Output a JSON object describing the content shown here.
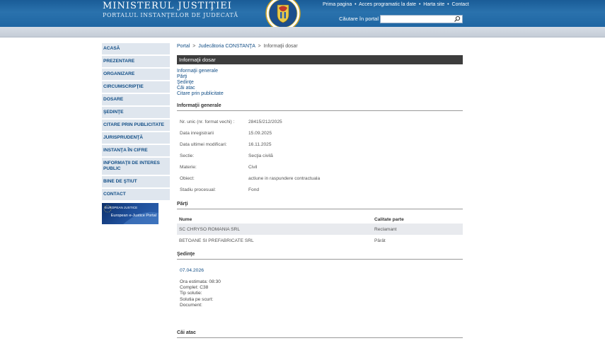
{
  "header": {
    "title": "MINISTERUL JUSTIŢIEI",
    "subtitle": "PORTALUL INSTANŢELOR DE JUDECATĂ",
    "links": [
      "Prima pagina",
      "Acces programatic la date",
      "Harta site",
      "Contact"
    ],
    "search_label": "Căutare în portal",
    "search_value": ""
  },
  "menu": {
    "items": [
      "ACASĂ",
      "PREZENTARE",
      "ORGANIZARE",
      "CIRCUMSCRIPŢIE",
      "DOSARE",
      "ŞEDINŢE",
      "CITARE PRIN PUBLICITATE",
      "JURISPRUDENŢĂ",
      "INSTANŢA ÎN CIFRE",
      "INFORMAŢII DE INTERES PUBLIC",
      "BINE DE ŞTIUT",
      "CONTACT"
    ],
    "ejustice_top": "EUROPEAN JUSTICE",
    "ejustice_label": "European e-Justice Portal"
  },
  "breadcrumb": {
    "portal": "Portal",
    "court": "Judecătoria CONSTANŢA",
    "current": "Informaţii dosar"
  },
  "page_title": "Informaţii dosar",
  "anchors": [
    "Informaţii generale",
    "Părţi",
    "Şedinţe",
    "Căi atac",
    "Citare prin publicitate"
  ],
  "info": {
    "heading": "Informaţii generale",
    "rows": [
      {
        "label": "Nr. unic (nr. format vechi) :",
        "value": "28415/212/2025"
      },
      {
        "label": "Data inregistrarii",
        "value": "15.09.2025"
      },
      {
        "label": "Data ultimei modificari:",
        "value": "16.11.2025"
      },
      {
        "label": "Sectie:",
        "value": "Secţia civilă"
      },
      {
        "label": "Materie:",
        "value": "Civil"
      },
      {
        "label": "Obiect:",
        "value": "actiune in raspundere contractuala"
      },
      {
        "label": "Stadiu procesual:",
        "value": "Fond"
      }
    ]
  },
  "parti": {
    "heading": "Părţi",
    "columns": [
      "Nume",
      "Calitate parte"
    ],
    "rows": [
      {
        "name": "SC CHRYSO ROMANIA SRL",
        "role": "Reclamant"
      },
      {
        "name": "BETOANE SI PREFABRICATE SRL",
        "role": "Pârât"
      }
    ]
  },
  "sedinte": {
    "heading": "Şedinţe",
    "date": "07.04.2026",
    "details": [
      "Ora estimata: 08:30",
      "Complet: C38",
      "Tip solutie:",
      "Solutia pe scurt:",
      "Document:"
    ]
  },
  "cai_atac": {
    "heading": "Căi atac"
  },
  "colors": {
    "header_blue": "#1f66a3",
    "link_blue": "#124e86",
    "menu_bg": "#dfe6ee",
    "title_bar": "#3d3d3d"
  }
}
